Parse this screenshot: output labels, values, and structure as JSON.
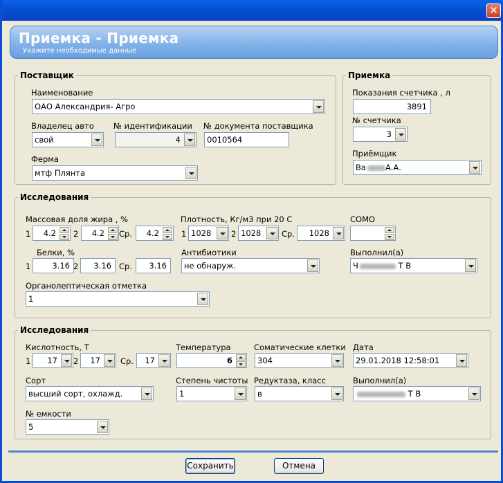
{
  "window": {
    "close_glyph": "✕"
  },
  "header": {
    "title": "Приемка - Приемка",
    "subtitle": "Укажите необходимые данные"
  },
  "supplier": {
    "legend": "Поставщик",
    "name_label": "Наименование",
    "name_value": "ОАО Александрия- Агро",
    "owner_label": "Владелец авто",
    "owner_value": "свой",
    "id_label": "№ идентификации",
    "id_value": "4",
    "doc_label": "№ документа поставщика",
    "doc_value": "0010564",
    "farm_label": "Ферма",
    "farm_value": "мтф Плянта"
  },
  "reception": {
    "legend": "Приемка",
    "meter_label": "Показания счетчика , л",
    "meter_value": "3891",
    "meter_no_label": "№ счетчика",
    "meter_no_value": "3",
    "receiver_label": "Приёмщик",
    "receiver_value_prefix": "Ва",
    "receiver_value_suffix": "А.А."
  },
  "research1": {
    "legend": "Исследования",
    "fat_label": "Массовая доля жира , %",
    "fat_1": "4.2",
    "fat_2": "4.2",
    "fat_avg": "4.2",
    "density_label": "Плотность, Кг/м3 при 20  С",
    "density_1": "1028",
    "density_2": "1028",
    "density_avg": "1028",
    "somo_label": "СОМО",
    "somo_value": "",
    "protein_label": "Белки, %",
    "protein_1": "3.16",
    "protein_2": "3.16",
    "protein_avg": "3.16",
    "antibiotics_label": "Антибиотики",
    "antibiotics_value": "не обнаруж.",
    "performer_label": "Выполнил(а)",
    "performer_value_prefix": "Ч",
    "performer_value_suffix": "Т В",
    "organoleptic_label": "Органолептическая отметка",
    "organoleptic_value": "1",
    "n1": "1",
    "n2": "2",
    "avg": "Ср."
  },
  "research2": {
    "legend": "Исследования",
    "acidity_label": "Кислотность, Т",
    "acidity_1": "17",
    "acidity_2": "17",
    "acidity_avg": "17",
    "temp_label": "Температура",
    "temp_value": "6",
    "somatic_label": "Соматические клетки",
    "somatic_value": "304",
    "date_label": "Дата",
    "date_value": "29.01.2018 12:58:01",
    "grade_label": "Сорт",
    "grade_value": "высший сорт, охлажд.",
    "purity_label": "Степень чистоты",
    "purity_value": "1",
    "reductase_label": "Редуктаза, класс",
    "reductase_value": "в",
    "performer_label": "Выполнил(а)",
    "performer_value_suffix": "Т В",
    "tank_label": "№ емкости",
    "tank_value": "5",
    "n1": "1",
    "n2": "2",
    "avg": "Ср."
  },
  "buttons": {
    "save": "Сохранить",
    "cancel": "Отмена"
  }
}
